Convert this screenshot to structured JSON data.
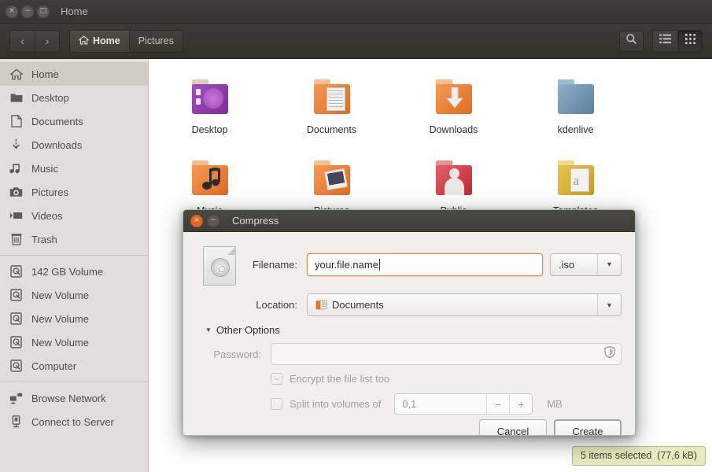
{
  "window": {
    "title": "Home",
    "controls": [
      {
        "name": "close",
        "glyph": "×"
      },
      {
        "name": "minimize",
        "glyph": "−"
      },
      {
        "name": "maximize",
        "glyph": "□"
      }
    ]
  },
  "toolbar": {
    "back_glyph": "‹",
    "forward_glyph": "›",
    "breadcrumbs": [
      {
        "label": "Home",
        "icon": "home-icon",
        "active": true
      },
      {
        "label": "Pictures",
        "icon": "",
        "active": false
      }
    ],
    "search_icon": "search-icon",
    "list_view_icon": "list-view-icon",
    "grid_view_icon": "grid-view-icon",
    "active_view": "grid"
  },
  "sidebar": {
    "items": [
      {
        "label": "Home",
        "icon": "home-icon",
        "selected": true,
        "sep_after": false
      },
      {
        "label": "Desktop",
        "icon": "folder-icon",
        "selected": false,
        "sep_after": false
      },
      {
        "label": "Documents",
        "icon": "document-icon",
        "selected": false,
        "sep_after": false
      },
      {
        "label": "Downloads",
        "icon": "download-icon",
        "selected": false,
        "sep_after": false
      },
      {
        "label": "Music",
        "icon": "music-icon",
        "selected": false,
        "sep_after": false
      },
      {
        "label": "Pictures",
        "icon": "camera-icon",
        "selected": false,
        "sep_after": false
      },
      {
        "label": "Videos",
        "icon": "video-icon",
        "selected": false,
        "sep_after": false
      },
      {
        "label": "Trash",
        "icon": "trash-icon",
        "selected": false,
        "sep_after": true
      },
      {
        "label": "142 GB Volume",
        "icon": "drive-icon",
        "selected": false,
        "sep_after": false
      },
      {
        "label": "New Volume",
        "icon": "drive-icon",
        "selected": false,
        "sep_after": false
      },
      {
        "label": "New Volume",
        "icon": "drive-icon",
        "selected": false,
        "sep_after": false
      },
      {
        "label": "New Volume",
        "icon": "drive-icon",
        "selected": false,
        "sep_after": false
      },
      {
        "label": "Computer",
        "icon": "drive-icon",
        "selected": false,
        "sep_after": true
      },
      {
        "label": "Browse Network",
        "icon": "network-icon",
        "selected": false,
        "sep_after": false
      },
      {
        "label": "Connect to Server",
        "icon": "server-icon",
        "selected": false,
        "sep_after": false
      }
    ]
  },
  "files": {
    "rows": [
      [
        {
          "label": "Desktop",
          "kind": "folder-special",
          "color": "#8b3fa0",
          "color2": "#b060c8",
          "tab": "#d8d2b8"
        },
        {
          "label": "Documents",
          "kind": "folder-doc",
          "color": "#e8702a",
          "color2": "#f59a54",
          "tab": "#f7bf8d"
        },
        {
          "label": "Downloads",
          "kind": "folder-down",
          "color": "#e8702a",
          "color2": "#f59a54",
          "tab": "#f7bf8d"
        },
        {
          "label": "kdenlive",
          "kind": "folder-plain",
          "color": "#5b7f9c",
          "color2": "#7fa3bd",
          "tab": "#9fbcd1"
        }
      ],
      [
        {
          "label": "Music",
          "kind": "folder-music",
          "color": "#e8702a",
          "color2": "#f59a54",
          "tab": "#f7bf8d"
        },
        {
          "label": "Pictures",
          "kind": "folder-pic",
          "color": "#e8702a",
          "color2": "#f59a54",
          "tab": "#f7bf8d"
        },
        {
          "label": "Public",
          "kind": "folder-public",
          "color": "#c9343c",
          "color2": "#e06068",
          "tab": "#e89094"
        },
        {
          "label": "Templates",
          "kind": "folder-tmpl",
          "color": "#d4a52a",
          "color2": "#e8c456",
          "tab": "#eed98c"
        }
      ],
      [
        {
          "label": "",
          "kind": "folder-video",
          "color": "#e8702a",
          "color2": "#f59a54",
          "tab": "#f7bf8d"
        },
        {
          "label": "",
          "kind": "folder-green",
          "color": "#6aa83c",
          "color2": "#8cc45e",
          "tab": "#b0d88e"
        },
        {
          "label": "",
          "kind": "doc-orange",
          "color": "#e06a2a",
          "color2": "#ef8c4e",
          "tab": ""
        },
        {
          "label": "",
          "kind": "doc-light",
          "color": "#e9eef2",
          "color2": "#f7fafc",
          "tab": ""
        }
      ]
    ]
  },
  "status": {
    "text": "5 items selected",
    "size": "(77,6 kB)"
  },
  "dialog": {
    "title": "Compress",
    "controls": [
      {
        "name": "close",
        "glyph": "×",
        "focused": true
      },
      {
        "name": "minimize",
        "glyph": "−",
        "focused": false
      }
    ],
    "icon": "iso-file-icon",
    "filename_label": "Filename:",
    "filename_value": "your.file.name",
    "extension_value": ".iso",
    "location_label": "Location:",
    "location_value": "Documents",
    "other_options_label": "Other Options",
    "password_label": "Password:",
    "password_value": "",
    "password_icon": "shield-icon",
    "encrypt_label": "Encrypt the file list too",
    "encrypt_state": "indeterminate",
    "split_label": "Split into volumes of",
    "split_state": "unchecked",
    "split_value": "0,1",
    "split_minus": "−",
    "split_plus": "+",
    "split_unit": "MB",
    "cancel_label": "Cancel",
    "create_label": "Create"
  }
}
